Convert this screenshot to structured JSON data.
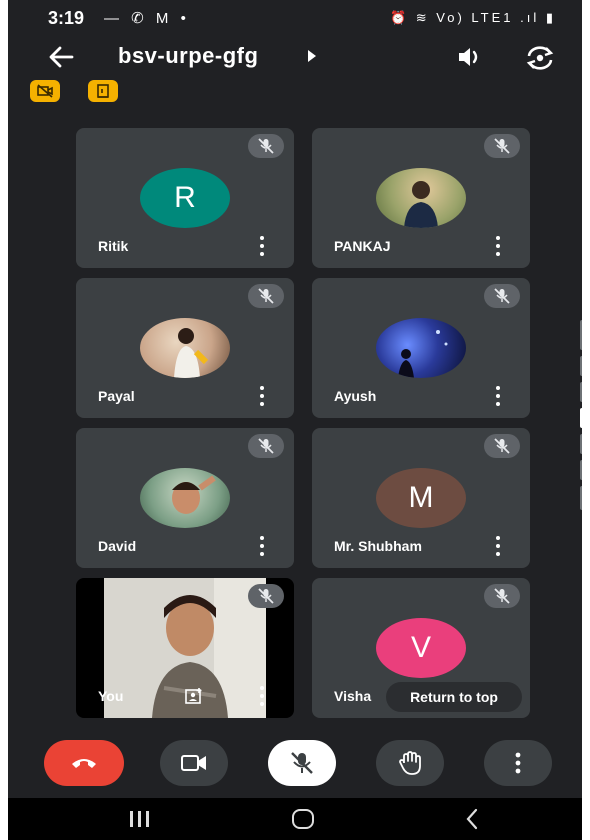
{
  "status_bar": {
    "time": "3:19",
    "left_icons": "— ✆ M •",
    "right_icons": "⏰ ≋ Vo) LTE1 .ıl ▮"
  },
  "meeting": {
    "title": "bsv-urpe-gfg"
  },
  "participants": [
    {
      "name": "Ritik",
      "initial": "R",
      "avatar_color": "#00897b"
    },
    {
      "name": "PANKAJ",
      "initial": "",
      "avatar_color": "#9aa36a"
    },
    {
      "name": "Payal",
      "initial": "",
      "avatar_color": "#caa58a"
    },
    {
      "name": "Ayush",
      "initial": "",
      "avatar_color": "#16206a"
    },
    {
      "name": "David",
      "initial": "",
      "avatar_color": "#7c9f86"
    },
    {
      "name": "Mr. Shubham",
      "initial": "M",
      "avatar_color": "#6d4c41"
    },
    {
      "name": "You"
    },
    {
      "name": "Visha",
      "initial": "V",
      "avatar_color": "#ea3f7c"
    }
  ],
  "return_to_top_label": "Return to top",
  "colors": {
    "end_call": "#ea4335",
    "control_bg": "#3c4043",
    "mic_active": "#ffffff",
    "badge": "#f5b100"
  },
  "icons": [
    "back-arrow-icon",
    "speaker-icon",
    "camera-flip-icon",
    "mic-off-icon",
    "video-camera-icon",
    "raise-hand-icon",
    "more-vert-icon",
    "present-icon",
    "end-call-icon"
  ]
}
